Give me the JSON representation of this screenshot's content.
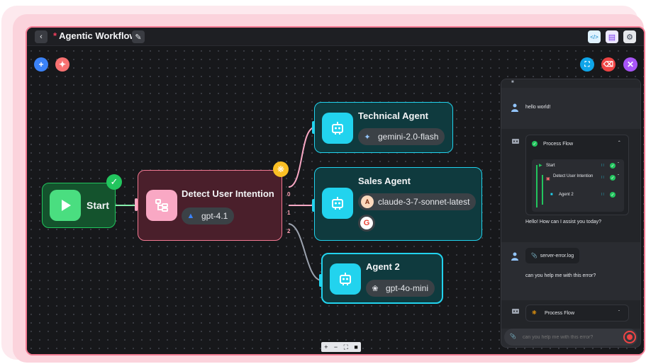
{
  "window": {
    "title": "Agentic Workflow",
    "unsaved_marker": "*"
  },
  "nodes": {
    "start": {
      "label": "Start"
    },
    "detect": {
      "label": "Detect User Intention",
      "model": "gpt-4.1"
    },
    "technical": {
      "label": "Technical Agent",
      "model": "gemini-2.0-flash"
    },
    "sales": {
      "label": "Sales Agent",
      "model": "claude-3-7-sonnet-latest"
    },
    "agent2": {
      "label": "Agent 2",
      "model": "gpt-4o-mini"
    }
  },
  "edges": {
    "label0": "0",
    "label1": "1",
    "label2": "2"
  },
  "chat": {
    "messages": {
      "user1": "hello world!",
      "bot_reply": "Hello! How can I assist you today?",
      "attachment": "server-error.log",
      "user2": "can you help me with this error?"
    },
    "process_flow": {
      "title": "Process Flow",
      "steps": [
        "Start",
        "Detect User Intention",
        "Agent 2"
      ]
    },
    "process_flow_pending": {
      "title": "Process Flow"
    },
    "input": {
      "placeholder": "can you help me with this error?"
    }
  },
  "colors": {
    "accent": "#f47a93",
    "cyan": "#22d3ee",
    "pink": "#f9a8c4",
    "green": "#22c55e"
  },
  "icons": [
    "back-icon",
    "edit-icon",
    "code-icon",
    "save-icon",
    "settings-icon",
    "plus-icon",
    "magic-icon",
    "fit-view-icon",
    "eraser-icon",
    "close-icon",
    "robot-icon",
    "user-icon",
    "play-icon",
    "router-icon",
    "paperclip-icon",
    "record-icon"
  ]
}
